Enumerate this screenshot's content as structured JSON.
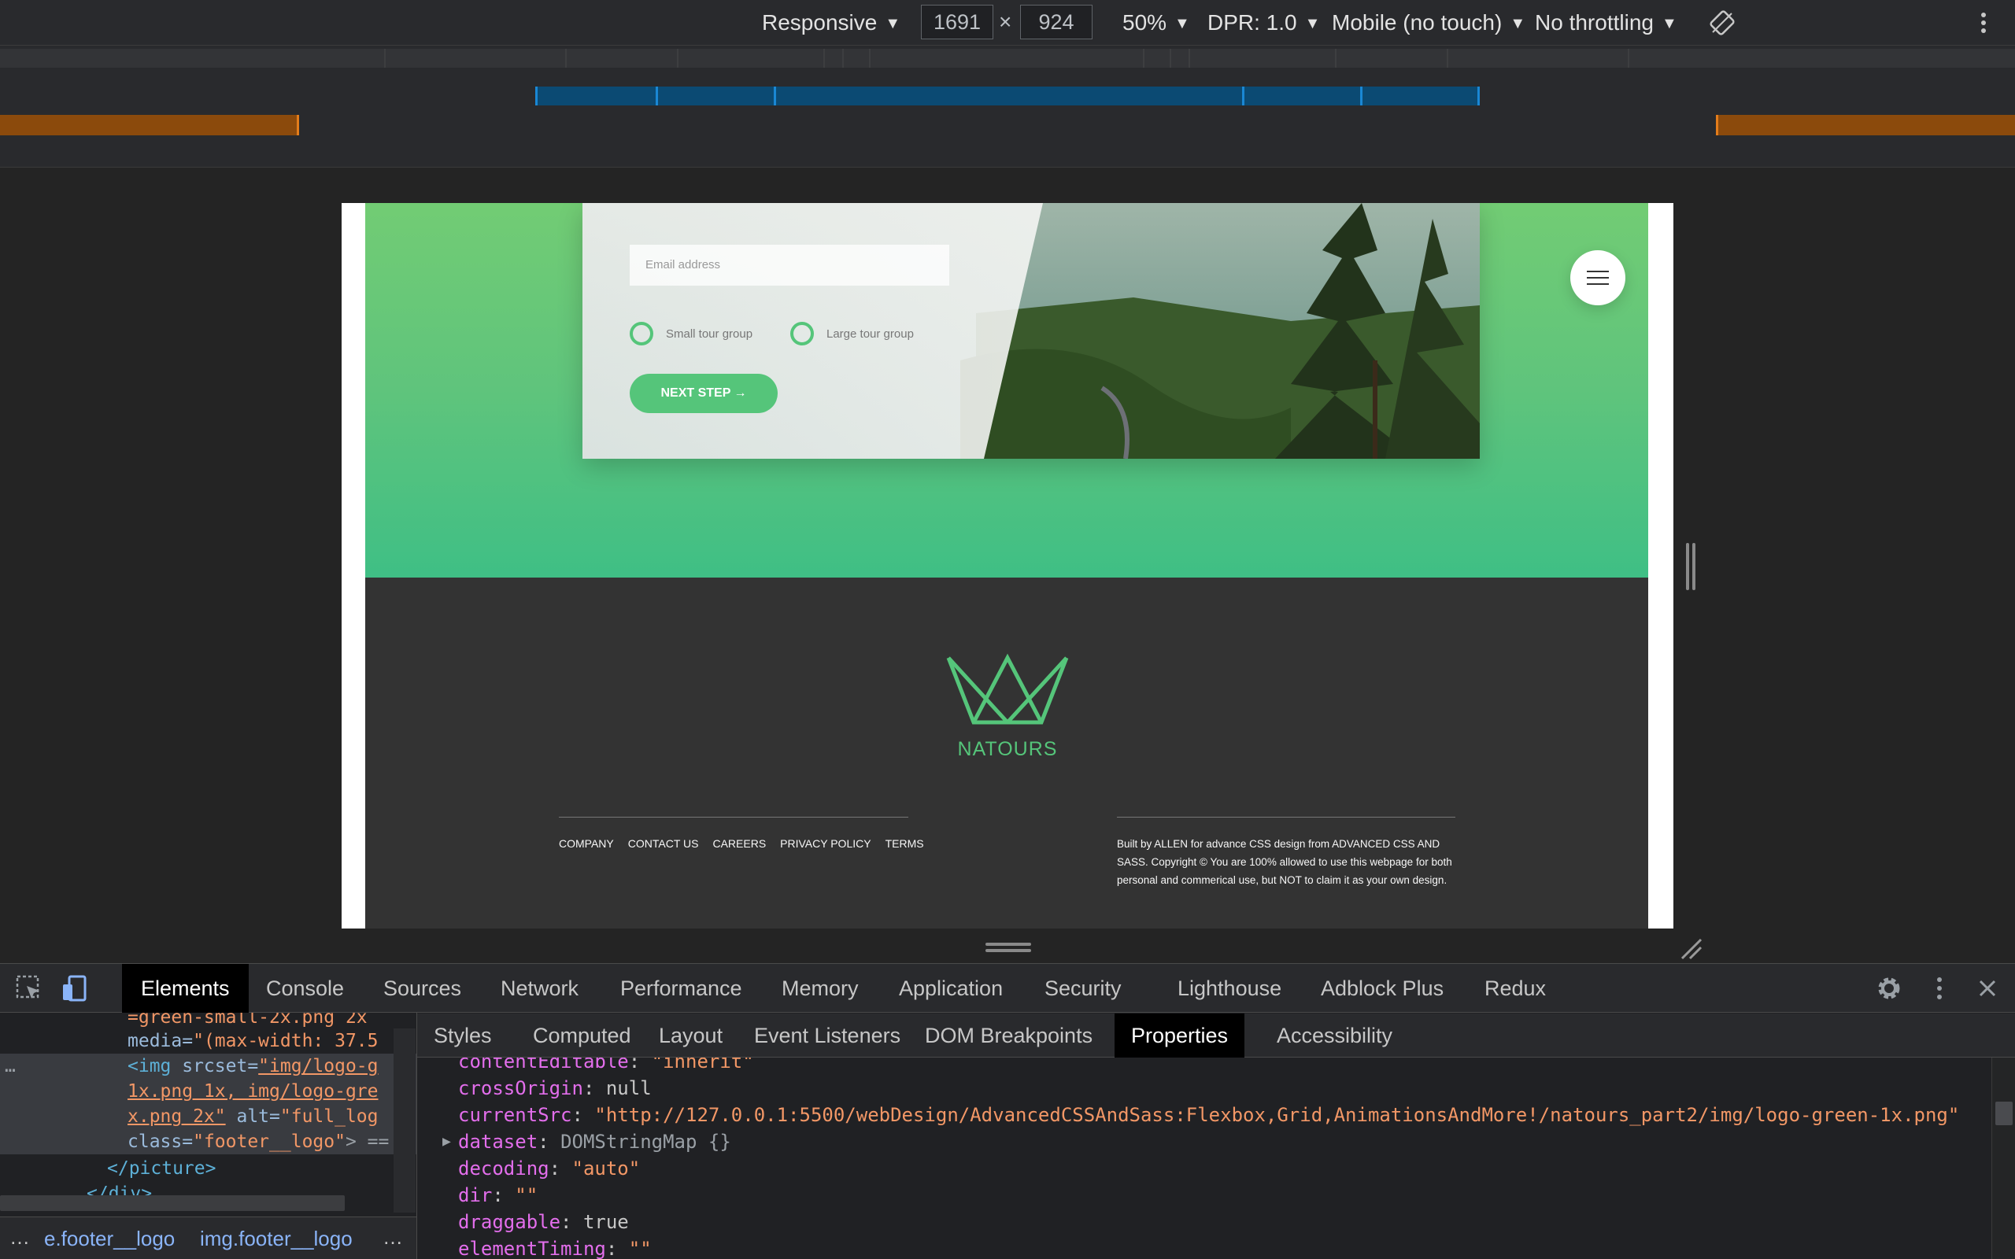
{
  "device_toolbar": {
    "device": "Responsive",
    "width": "1691",
    "height": "924",
    "times": "×",
    "zoom": "50%",
    "dpr": "DPR: 1.0",
    "device_type": "Mobile (no touch)",
    "throttling": "No throttling"
  },
  "page": {
    "email_placeholder": "Email address",
    "radio_small": "Small tour group",
    "radio_large": "Large tour group",
    "next_button": "NEXT STEP →",
    "footer_logo_text": "NATOURS",
    "footer_nav": [
      "COMPANY",
      "CONTACT US",
      "CAREERS",
      "PRIVACY POLICY",
      "TERMS"
    ],
    "copyright": "Built by ALLEN for advance CSS design from ADVANCED CSS AND SASS. Copyright © You are 100% allowed to use this webpage for both personal and commerical use, but NOT to claim it as your own design."
  },
  "devtools": {
    "tabs": [
      "Elements",
      "Console",
      "Sources",
      "Network",
      "Performance",
      "Memory",
      "Application",
      "Security",
      "Lighthouse",
      "Adblock Plus",
      "Redux"
    ],
    "active_tab": "Elements",
    "sub_tabs": [
      "Styles",
      "Computed",
      "Layout",
      "Event Listeners",
      "DOM Breakpoints",
      "Properties",
      "Accessibility"
    ],
    "active_sub_tab": "Properties",
    "elements_code": {
      "l1": "=green-small-2x.png 2x",
      "l2_attr": "media=",
      "l2_val": "\"(max-width: 37.5",
      "l3_tag": "<img",
      "l3_attr": " srcset=",
      "l3_val": "\"img/logo-g",
      "l4_val": "1x.png 1x, img/logo-gre",
      "l5_val": "x.png 2x\"",
      "l5_attr": " alt=",
      "l5_val2": "\"full_log",
      "l6_attr": "class=",
      "l6_val": "\"footer__logo\"",
      "l6_tail": "> ==",
      "l7": "</picture>",
      "l8": "</div>",
      "ellipsis": "…"
    },
    "breadcrumbs": [
      "…",
      "e.footer__logo",
      "img.footer__logo",
      "…"
    ],
    "properties": [
      {
        "key": "contentEditable",
        "value": "\"inherit\"",
        "type": "str"
      },
      {
        "key": "crossOrigin",
        "value": "null",
        "type": "kw"
      },
      {
        "key": "currentSrc",
        "value": "\"http://127.0.0.1:5500/webDesign/AdvancedCSSAndSass:Flexbox,Grid,AnimationsAndMore!/natours_part2/img/logo-green-1x.png\"",
        "type": "str"
      },
      {
        "key": "dataset",
        "value": "DOMStringMap {}",
        "type": "obj"
      },
      {
        "key": "decoding",
        "value": "\"auto\"",
        "type": "str"
      },
      {
        "key": "dir",
        "value": "\"\"",
        "type": "str"
      },
      {
        "key": "draggable",
        "value": "true",
        "type": "kw"
      },
      {
        "key": "elementTiming",
        "value": "\"\"",
        "type": "str"
      }
    ]
  },
  "colors": {
    "brand_green": "#55c57a",
    "footer_bg": "#333333",
    "devtools_bg": "#202124"
  },
  "icons": [
    "chevron-down-icon",
    "rotate-icon",
    "more-vert-icon",
    "inspect-icon",
    "device-toggle-icon",
    "gear-icon",
    "close-icon",
    "hamburger-icon",
    "expand-triangle-icon"
  ]
}
